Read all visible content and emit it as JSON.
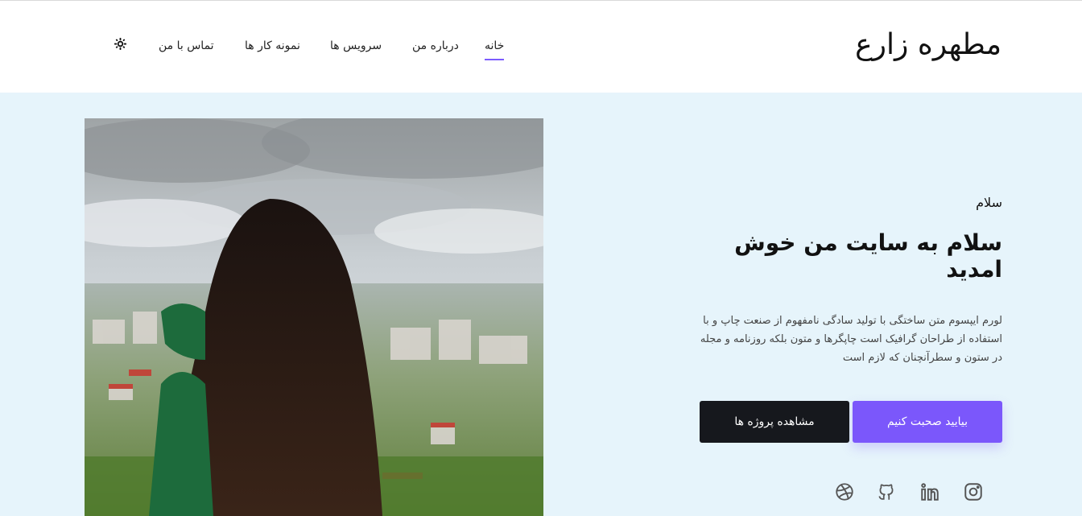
{
  "header": {
    "brand": "مطهره زارع",
    "nav": [
      {
        "label": "خانه",
        "active": true
      },
      {
        "label": "درباره من",
        "active": false
      },
      {
        "label": "سرویس ها",
        "active": false
      },
      {
        "label": "نمونه کار ها",
        "active": false
      },
      {
        "label": "تماس با من",
        "active": false
      }
    ],
    "theme_icon": "sun-icon"
  },
  "hero": {
    "greeting": "سلام",
    "title": "سلام به سایت من خوش امدید",
    "description": "لورم ایپسوم متن ساختگی با تولید سادگی نامفهوم از صنعت چاپ و با استفاده از طراحان گرافیک است چاپگرها و متون بلکه روزنامه و مجله در ستون و سطرآنچنان که لازم است",
    "primary_button": "بیایید صحبت کنیم",
    "secondary_button": "مشاهده پروژه ها",
    "socials": [
      "instagram-icon",
      "linkedin-icon",
      "github-icon",
      "dribbble-icon"
    ]
  },
  "colors": {
    "accent": "#7b57fb",
    "hero_bg": "#e6f4fb",
    "dark_button": "#16181d"
  }
}
